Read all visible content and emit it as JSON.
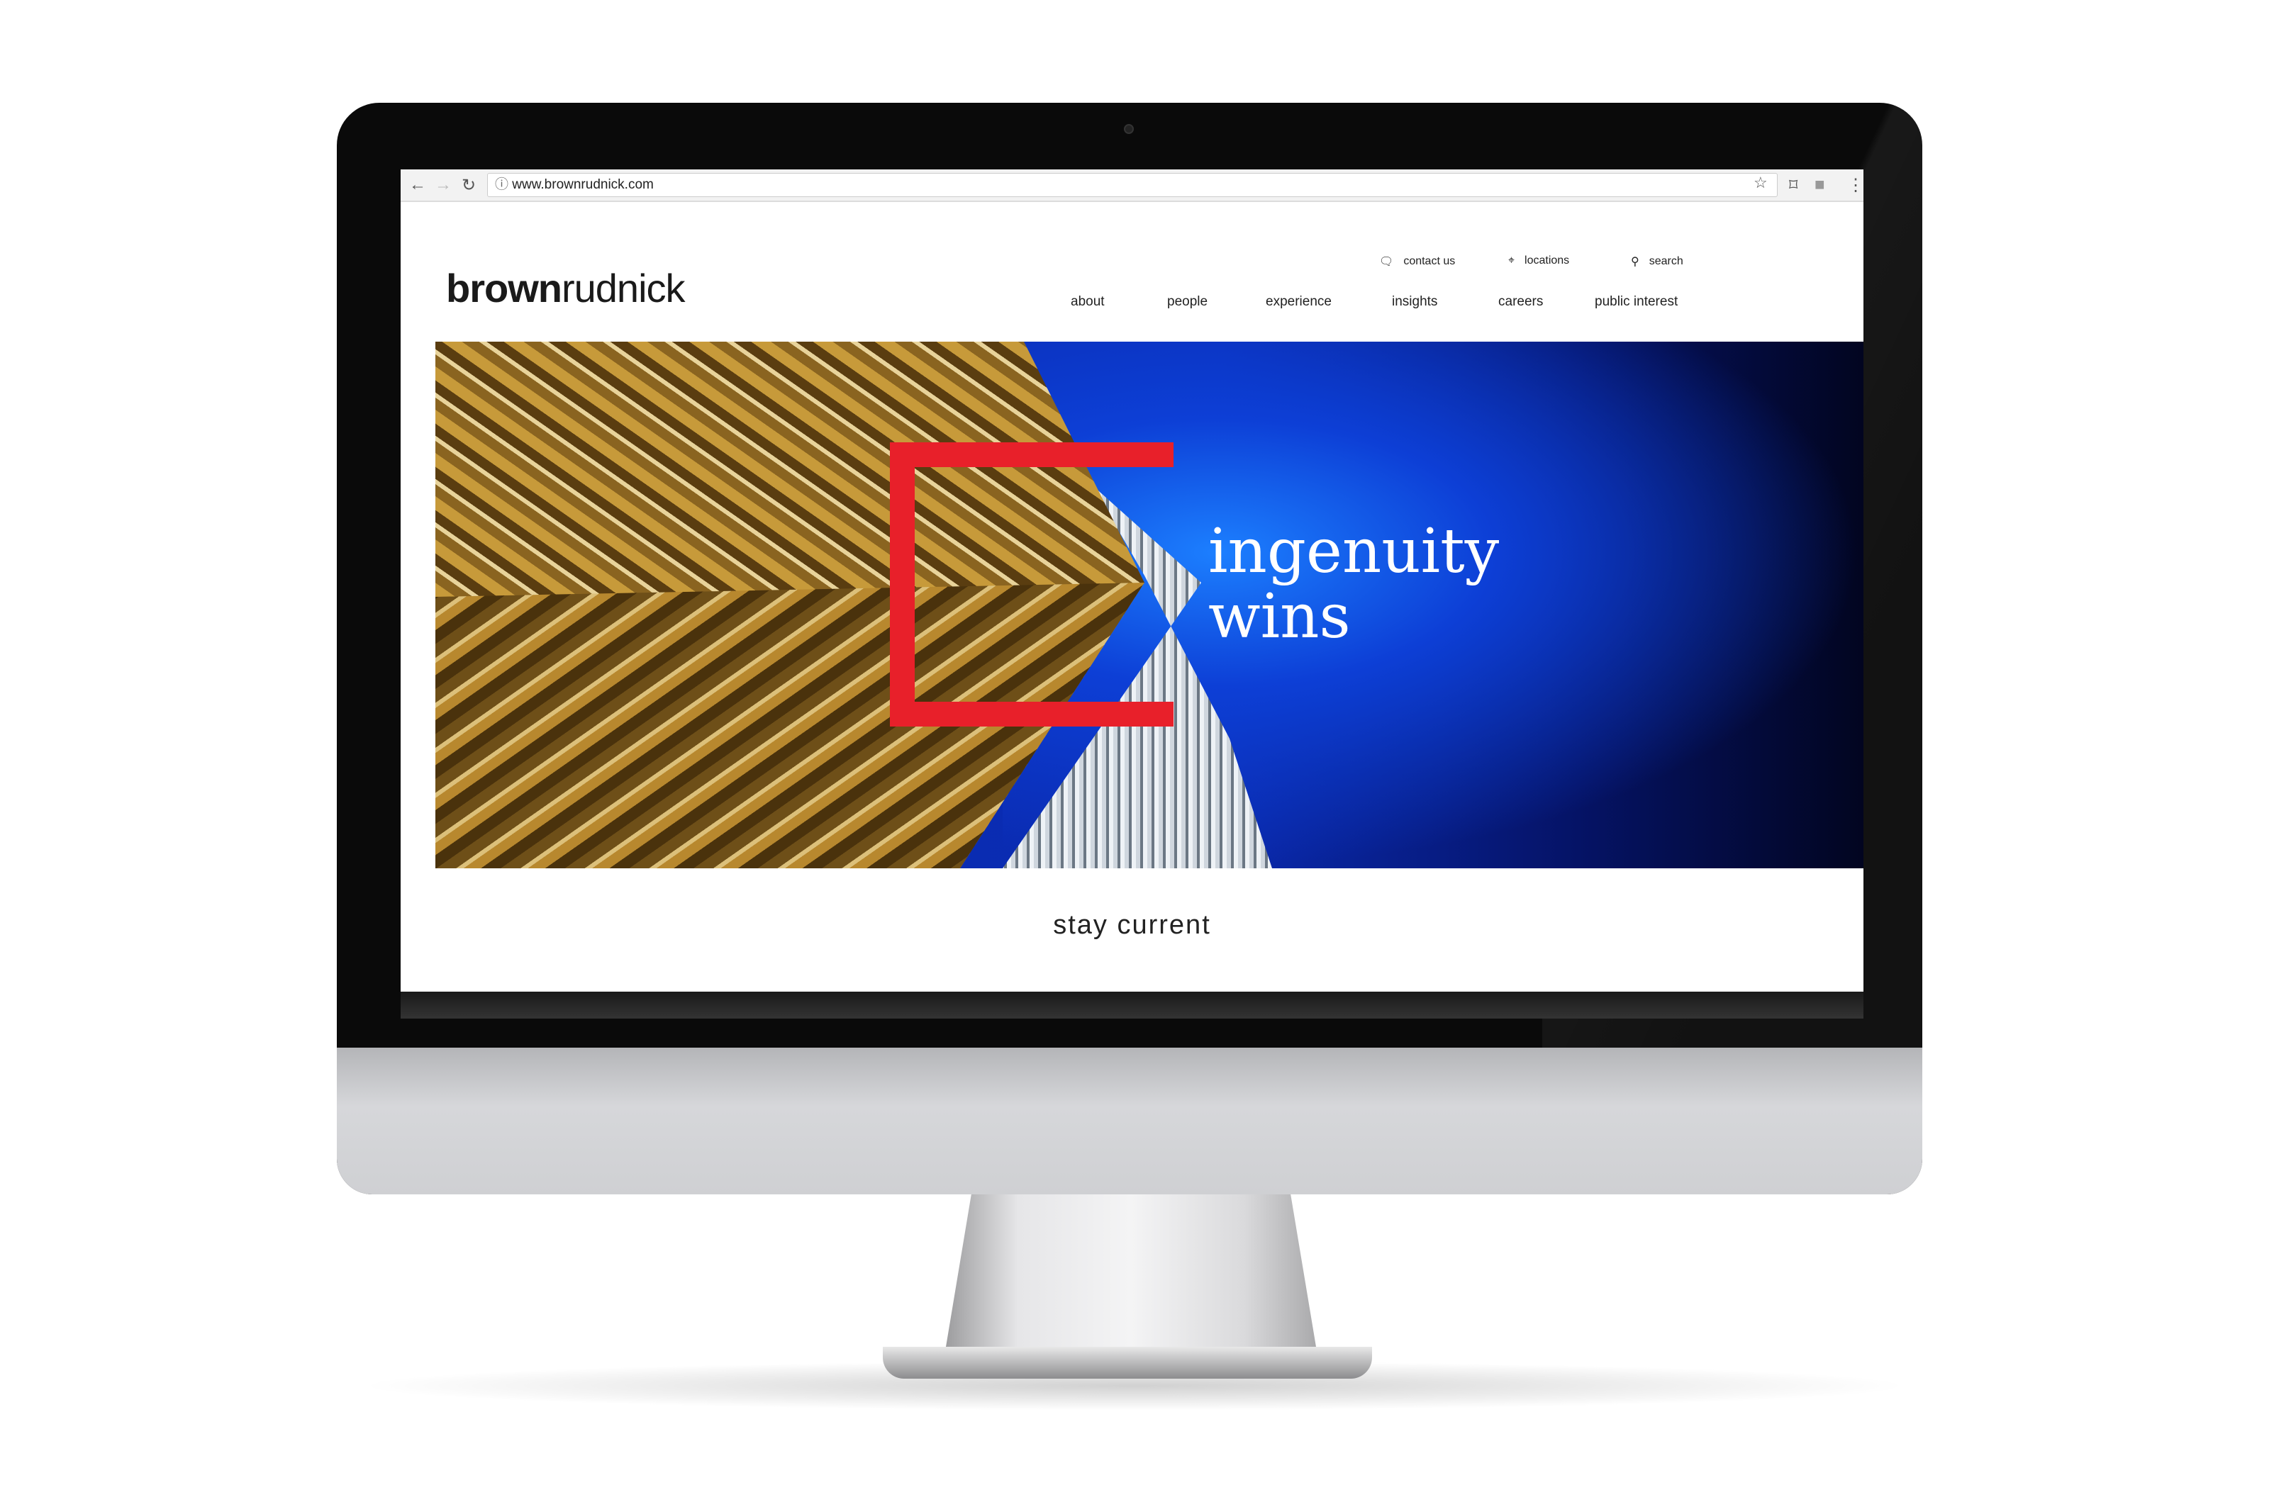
{
  "browser": {
    "url": "www.brownrudnick.com",
    "icons": [
      "back-arrow-icon",
      "forward-arrow-icon",
      "reload-icon",
      "info-icon",
      "star-icon",
      "cast-icon",
      "extension-icon",
      "menu-dots-icon"
    ]
  },
  "site": {
    "logo": {
      "bold": "brown",
      "light": "rudnick"
    },
    "utility": [
      {
        "label": "contact us",
        "icon": "chat-bubble-icon"
      },
      {
        "label": "locations",
        "icon": "map-pin-icon"
      },
      {
        "label": "search",
        "icon": "search-icon"
      }
    ],
    "nav": [
      "about",
      "people",
      "experience",
      "insights",
      "careers",
      "public interest"
    ],
    "hero": {
      "line1": "ingenuity",
      "line2": "wins",
      "accent": "#e8202a"
    },
    "section_title": "stay current"
  }
}
